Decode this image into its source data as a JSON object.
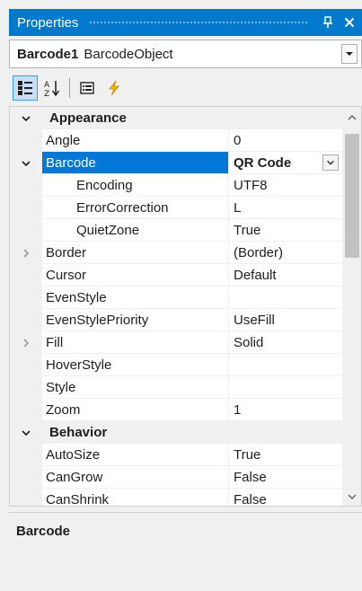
{
  "window": {
    "title": "Properties",
    "pin_icon": "pin-icon",
    "close_icon": "close-icon",
    "accent_color": "#007acc"
  },
  "object_selector": {
    "name": "Barcode1",
    "type": "BarcodeObject"
  },
  "toolbar": {
    "buttons": [
      {
        "name": "categorized-icon",
        "active": true
      },
      {
        "name": "alphabetical-icon",
        "active": false
      },
      {
        "name": "property-pages-icon",
        "active": false
      },
      {
        "name": "events-icon",
        "active": false
      }
    ]
  },
  "grid": {
    "categories": [
      {
        "label": "Appearance",
        "expanded": true,
        "properties": [
          {
            "name": "Angle",
            "value": "0"
          },
          {
            "name": "Barcode",
            "value": "QR Code",
            "selected": true,
            "expanded": true,
            "bold_value": true,
            "has_dropdown": true,
            "children": [
              {
                "name": "Encoding",
                "value": "UTF8"
              },
              {
                "name": "ErrorCorrection",
                "value": "L"
              },
              {
                "name": "QuietZone",
                "value": "True"
              }
            ]
          },
          {
            "name": "Border",
            "value": "(Border)",
            "expandable": true
          },
          {
            "name": "Cursor",
            "value": "Default"
          },
          {
            "name": "EvenStyle",
            "value": ""
          },
          {
            "name": "EvenStylePriority",
            "value": "UseFill"
          },
          {
            "name": "Fill",
            "value": "Solid",
            "expandable": true
          },
          {
            "name": "HoverStyle",
            "value": ""
          },
          {
            "name": "Style",
            "value": ""
          },
          {
            "name": "Zoom",
            "value": "1"
          }
        ]
      },
      {
        "label": "Behavior",
        "expanded": true,
        "properties": [
          {
            "name": "AutoSize",
            "value": "True"
          },
          {
            "name": "CanGrow",
            "value": "False"
          },
          {
            "name": "CanShrink",
            "value": "False"
          }
        ]
      }
    ]
  },
  "description": {
    "title": "Barcode",
    "text": ""
  },
  "colors": {
    "selection": "#0078d7",
    "category_background": "#f0f0f0"
  }
}
